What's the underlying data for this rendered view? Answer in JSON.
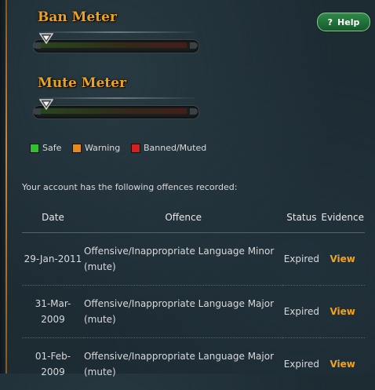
{
  "help": {
    "label": "Help",
    "icon": "?"
  },
  "ban_meter": {
    "title": "Ban Meter",
    "level": 0
  },
  "mute_meter": {
    "title": "Mute Meter",
    "level": 0
  },
  "legend": [
    {
      "label": "Safe",
      "color": "#2fbf2f"
    },
    {
      "label": "Warning",
      "color": "#e88a1a"
    },
    {
      "label": "Banned/Muted",
      "color": "#d42020"
    }
  ],
  "intro_text": "Your account has the following offences recorded:",
  "table": {
    "headers": {
      "date": "Date",
      "offence": "Offence",
      "status": "Status",
      "evidence": "Evidence"
    },
    "rows": [
      {
        "date": "29-Jan-2011",
        "offence": "Offensive/Inappropriate Language Minor (mute)",
        "status": "Expired",
        "evidence": "View"
      },
      {
        "date": "31-Mar-2009",
        "offence": "Offensive/Inappropriate Language Major (mute)",
        "status": "Expired",
        "evidence": "View"
      },
      {
        "date": "01-Feb-2009",
        "offence": "Offensive/Inappropriate Language Major (mute)",
        "status": "Expired",
        "evidence": "View"
      }
    ]
  }
}
